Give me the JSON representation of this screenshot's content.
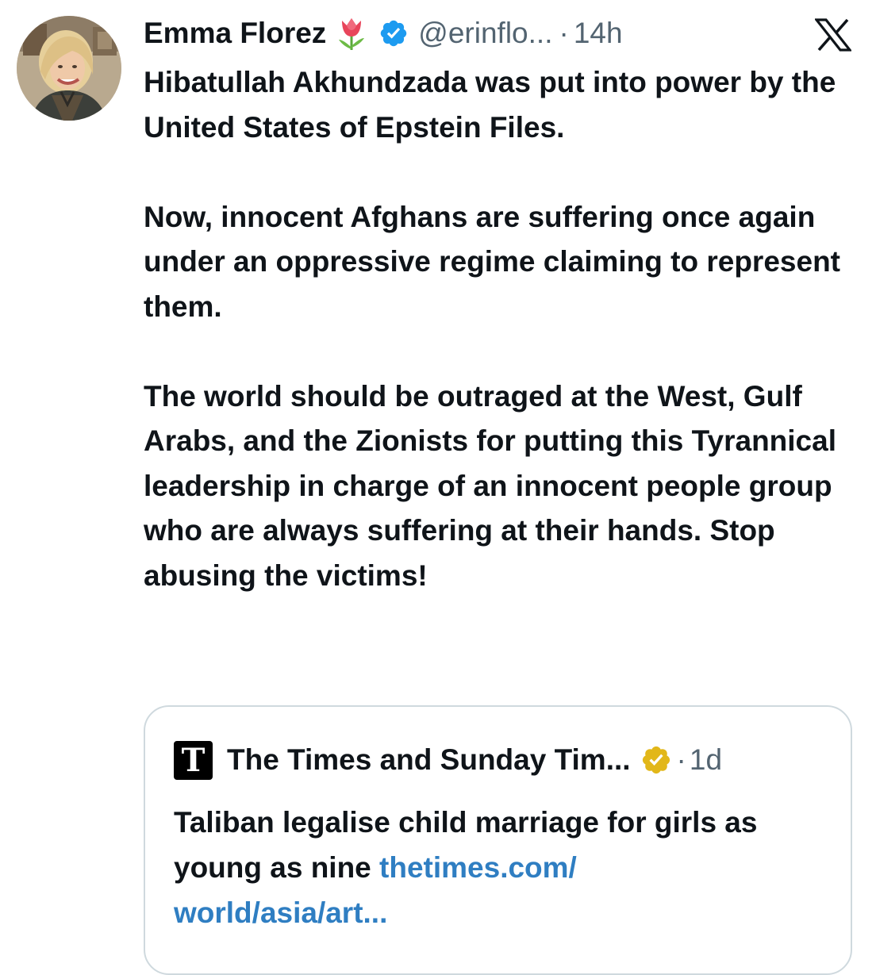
{
  "tweet": {
    "author_name": "Emma Florez",
    "handle": "@erinflo...",
    "separator": "·",
    "time": "14h",
    "paragraphs": [
      "Hibatullah Akhundzada was put into power by the United States of Epstein Files.",
      "Now, innocent Afghans are suffering once again under an oppressive regime claiming to represent them.",
      "The world should be outraged at the West, Gulf Arabs, and the Zionists for putting this Tyrannical leadership in charge of an innocent people group who are always suffering at their hands. Stop abusing the victims!"
    ],
    "icons": {
      "name_emoji": "tulip-icon",
      "verified": "verified-badge-icon",
      "platform": "x-logo-icon"
    }
  },
  "quoted_tweet": {
    "logo_letter": "T",
    "author_name": "The Times and Sunday Tim...",
    "separator": "·",
    "time": "1d",
    "text": "Taliban legalise child marriage for girls as young as nine ",
    "link_line1": "thetimes.com/",
    "link_line2": "world/asia/art...",
    "icons": {
      "verified": "gold-verified-badge-icon"
    }
  },
  "colors": {
    "text_primary": "#0f1419",
    "text_secondary": "#536471",
    "verified_blue": "#1d9bf0",
    "verified_gold": "#e2b719",
    "link": "#2f7ec2",
    "border": "#cfd9de"
  }
}
